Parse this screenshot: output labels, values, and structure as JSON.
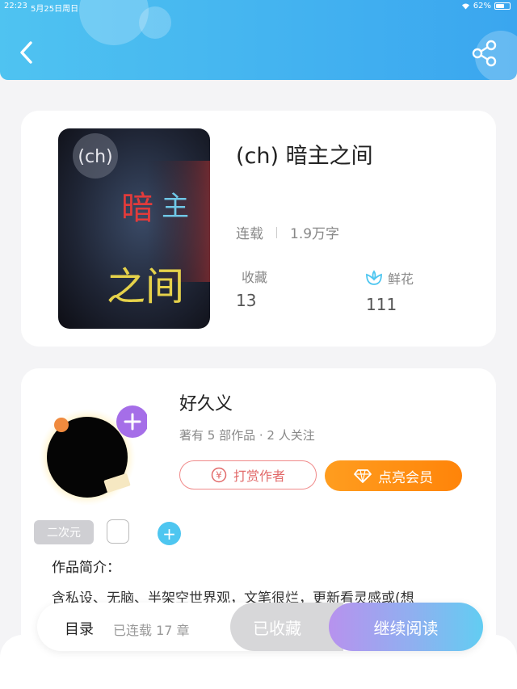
{
  "status": {
    "time": "22:23",
    "date": "5月25日周日",
    "battery": "62%",
    "battery_level": 0.62
  },
  "book": {
    "title": "(ch) 暗主之间",
    "status": "连载",
    "word_count": "1.9万字",
    "favorites_label": "收藏",
    "favorites_value": "13",
    "flowers_label": "鲜花",
    "flowers_value": "111",
    "cover_text": {
      "prefix": "(ch)",
      "line1a": "暗",
      "line1b": "主",
      "line2": "之间"
    }
  },
  "author": {
    "name": "好久义",
    "meta": "著有 5 部作品 · 2 人关注",
    "tip_label": "打赏作者",
    "vip_label": "点亮会员"
  },
  "tags": [
    "二次元"
  ],
  "intro": {
    "heading": "作品简介：",
    "text": "含私设、无脑、半架空世界观，文笔很烂，更新看灵感或(想"
  },
  "bottom": {
    "toc_label": "目录",
    "toc_count": "已连载 17 章",
    "collected_label": "已收藏",
    "read_label": "继续阅读"
  },
  "colors": {
    "header": "#3aa6ef",
    "vip": "#ff8409",
    "tip": "#e26a6a",
    "accent": "#4ec6f0"
  }
}
